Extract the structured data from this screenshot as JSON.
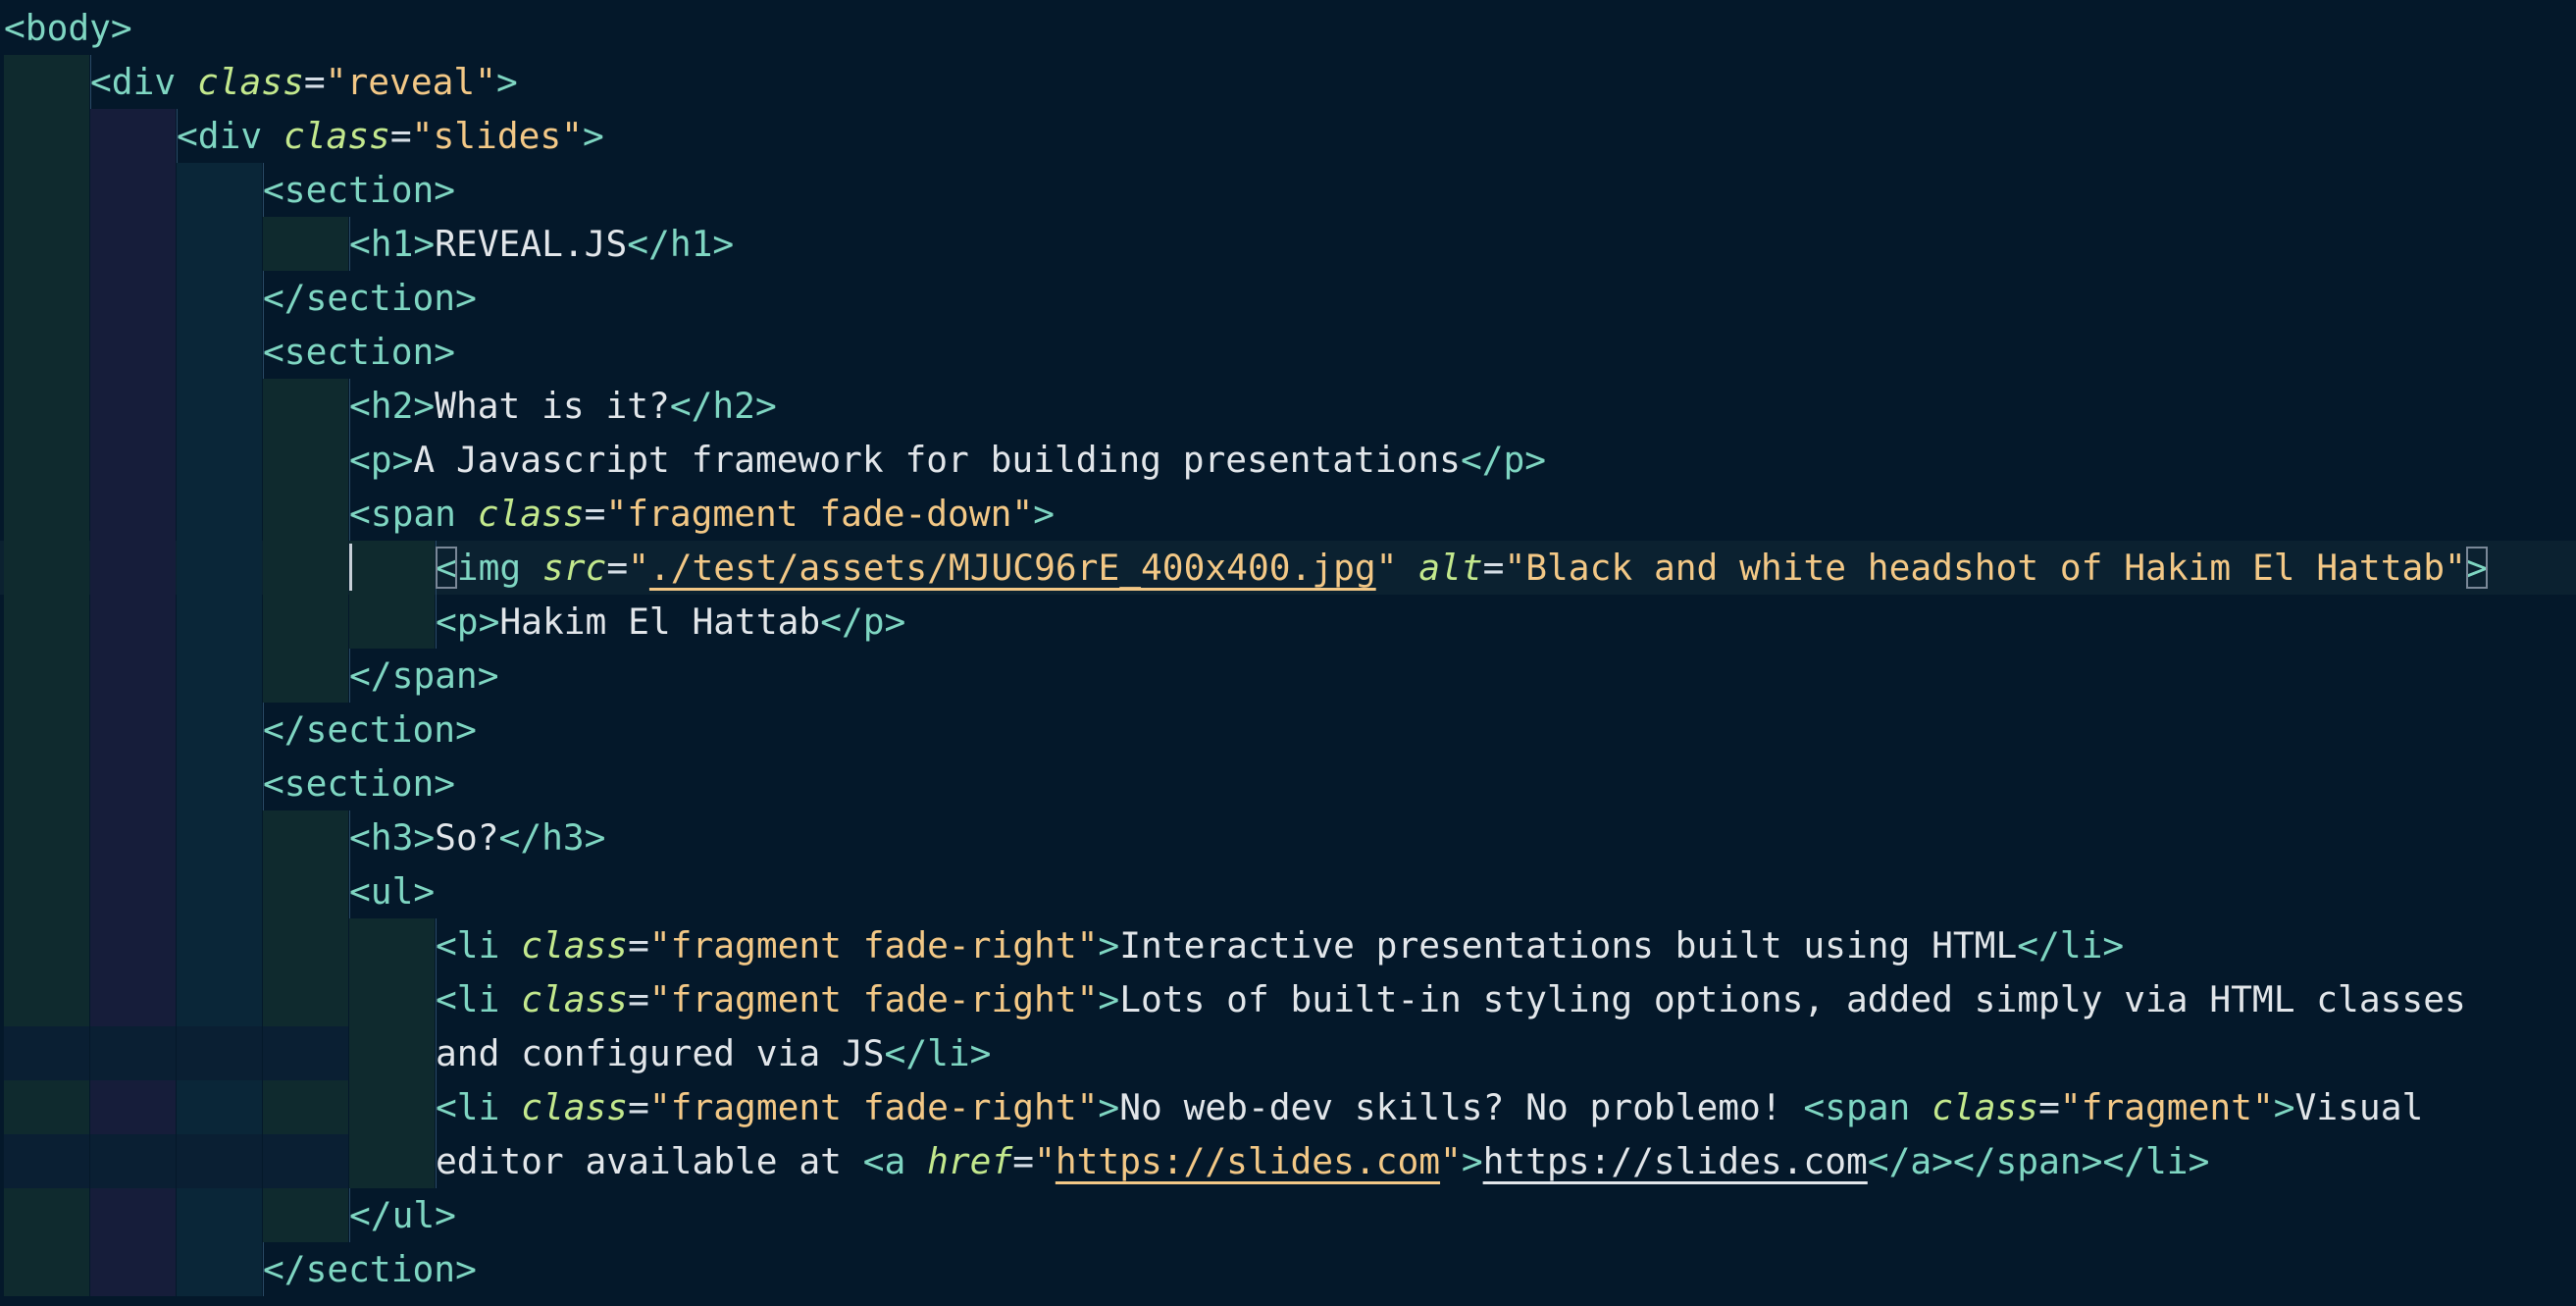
{
  "editor": {
    "language": "html",
    "lines": [
      {
        "indent": 0,
        "tokens": [
          [
            "t",
            "<body>"
          ]
        ]
      },
      {
        "indent": 1,
        "tokens": [
          [
            "t",
            "<div "
          ],
          [
            "a",
            "class"
          ],
          [
            "p",
            "="
          ],
          [
            "s",
            "\"reveal\""
          ],
          [
            "t",
            ">"
          ]
        ]
      },
      {
        "indent": 2,
        "tokens": [
          [
            "t",
            "<div "
          ],
          [
            "a",
            "class"
          ],
          [
            "p",
            "="
          ],
          [
            "s",
            "\"slides\""
          ],
          [
            "t",
            ">"
          ]
        ]
      },
      {
        "indent": 3,
        "tokens": [
          [
            "t",
            "<section>"
          ]
        ]
      },
      {
        "indent": 4,
        "tokens": [
          [
            "t",
            "<h1>"
          ],
          [
            "x",
            "REVEAL.JS"
          ],
          [
            "t",
            "</h1>"
          ]
        ]
      },
      {
        "indent": 3,
        "tokens": [
          [
            "t",
            "</section>"
          ]
        ]
      },
      {
        "indent": 3,
        "tokens": [
          [
            "t",
            "<section>"
          ]
        ]
      },
      {
        "indent": 4,
        "tokens": [
          [
            "t",
            "<h2>"
          ],
          [
            "x",
            "What is it?"
          ],
          [
            "t",
            "</h2>"
          ]
        ]
      },
      {
        "indent": 4,
        "tokens": [
          [
            "t",
            "<p>"
          ],
          [
            "x",
            "A Javascript framework for building presentations"
          ],
          [
            "t",
            "</p>"
          ]
        ]
      },
      {
        "indent": 4,
        "tokens": [
          [
            "t",
            "<span "
          ],
          [
            "a",
            "class"
          ],
          [
            "p",
            "="
          ],
          [
            "s",
            "\"fragment fade-down\""
          ],
          [
            "t",
            ">"
          ]
        ]
      },
      {
        "indent": 5,
        "active": true,
        "tokens": [
          [
            "t",
            "<img "
          ],
          [
            "a",
            "src"
          ],
          [
            "p",
            "="
          ],
          [
            "s",
            "\""
          ],
          [
            "link-s",
            "./test/assets/MJUC96rE_400x400.jpg"
          ],
          [
            "s",
            "\""
          ],
          [
            "p",
            " "
          ],
          [
            "a",
            "alt"
          ],
          [
            "p",
            "="
          ],
          [
            "s",
            "\"Black and white headshot of Hakim El Hattab\""
          ],
          [
            "t",
            ">"
          ]
        ]
      },
      {
        "indent": 5,
        "tokens": [
          [
            "t",
            "<p>"
          ],
          [
            "x",
            "Hakim El Hattab"
          ],
          [
            "t",
            "</p>"
          ]
        ]
      },
      {
        "indent": 4,
        "tokens": [
          [
            "t",
            "</span>"
          ]
        ]
      },
      {
        "indent": 3,
        "tokens": [
          [
            "t",
            "</section>"
          ]
        ]
      },
      {
        "indent": 3,
        "tokens": [
          [
            "t",
            "<section>"
          ]
        ]
      },
      {
        "indent": 4,
        "tokens": [
          [
            "t",
            "<h3>"
          ],
          [
            "x",
            "So?"
          ],
          [
            "t",
            "</h3>"
          ]
        ]
      },
      {
        "indent": 4,
        "tokens": [
          [
            "t",
            "<ul>"
          ]
        ]
      },
      {
        "indent": 5,
        "tokens": [
          [
            "t",
            "<li "
          ],
          [
            "a",
            "class"
          ],
          [
            "p",
            "="
          ],
          [
            "s",
            "\"fragment fade-right\""
          ],
          [
            "t",
            ">"
          ],
          [
            "x",
            "Interactive presentations built using HTML"
          ],
          [
            "t",
            "</li>"
          ]
        ]
      },
      {
        "indent": 5,
        "tokens": [
          [
            "t",
            "<li "
          ],
          [
            "a",
            "class"
          ],
          [
            "p",
            "="
          ],
          [
            "s",
            "\"fragment fade-right\""
          ],
          [
            "t",
            ">"
          ],
          [
            "x",
            "Lots of built-in styling options, added simply via HTML classes"
          ]
        ]
      },
      {
        "indent": 5,
        "wrap": true,
        "tokens": [
          [
            "x",
            "and configured via JS"
          ],
          [
            "t",
            "</li>"
          ]
        ]
      },
      {
        "indent": 5,
        "tokens": [
          [
            "t",
            "<li "
          ],
          [
            "a",
            "class"
          ],
          [
            "p",
            "="
          ],
          [
            "s",
            "\"fragment fade-right\""
          ],
          [
            "t",
            ">"
          ],
          [
            "x",
            "No web-dev skills? No problemo! "
          ],
          [
            "t",
            "<span "
          ],
          [
            "a",
            "class"
          ],
          [
            "p",
            "="
          ],
          [
            "s",
            "\"fragment\""
          ],
          [
            "t",
            ">"
          ],
          [
            "x",
            "Visual"
          ]
        ]
      },
      {
        "indent": 5,
        "wrap": true,
        "tokens": [
          [
            "x",
            "editor available at "
          ],
          [
            "t",
            "<a "
          ],
          [
            "a",
            "href"
          ],
          [
            "p",
            "="
          ],
          [
            "s",
            "\""
          ],
          [
            "link-s",
            "https://slides.com"
          ],
          [
            "s",
            "\""
          ],
          [
            "t",
            ">"
          ],
          [
            "link-x",
            "https://slides.com"
          ],
          [
            "t",
            "</a></span></li>"
          ]
        ]
      },
      {
        "indent": 4,
        "tokens": [
          [
            "t",
            "</ul>"
          ]
        ]
      },
      {
        "indent": 3,
        "tokens": [
          [
            "t",
            "</section>"
          ]
        ]
      }
    ]
  }
}
